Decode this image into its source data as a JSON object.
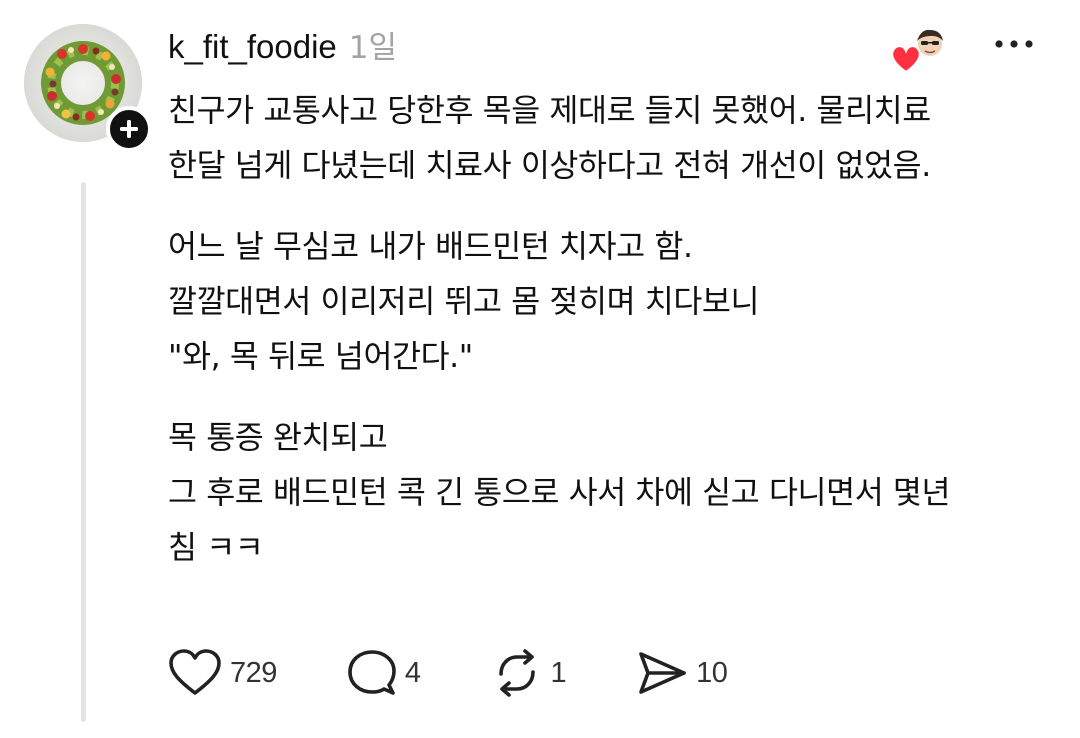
{
  "post": {
    "username": "k_fit_foodie",
    "timestamp": "1일",
    "paragraphs": [
      {
        "lines": [
          "친구가 교통사고 당한후 목을 제대로 들지 못했어. 물리치료",
          "한달 넘게 다녔는데 치료사 이상하다고 전혀 개선이 없었음."
        ]
      },
      {
        "lines": [
          "어느 날 무심코 내가 배드민턴 치자고 함.",
          "깔깔대면서 이리저리 뛰고 몸 젖히며 치다보니",
          "\"와, 목 뒤로 넘어간다.\""
        ]
      },
      {
        "lines": [
          "목 통증 완치되고",
          "그 후로 배드민턴 콕 긴 통으로 사서 차에 싣고 다니면서 몇년",
          "침 ㅋㅋ"
        ]
      }
    ]
  },
  "actions": {
    "like": {
      "icon": "heart-icon",
      "count": "729"
    },
    "reply": {
      "icon": "comment-bubble-icon",
      "count": "4"
    },
    "repost": {
      "icon": "repost-icon",
      "count": "1"
    },
    "share": {
      "icon": "send-icon",
      "count": "10"
    }
  },
  "icons": {
    "avatar": "salad-wreath-avatar",
    "follow": "plus-icon",
    "liked_by": "author-liked-heart-icon",
    "more": "more-dots-icon"
  },
  "colors": {
    "text": "#111111",
    "muted": "#a3a3a3",
    "heart": "#ff3040",
    "thread_line": "#e4e4e4"
  }
}
